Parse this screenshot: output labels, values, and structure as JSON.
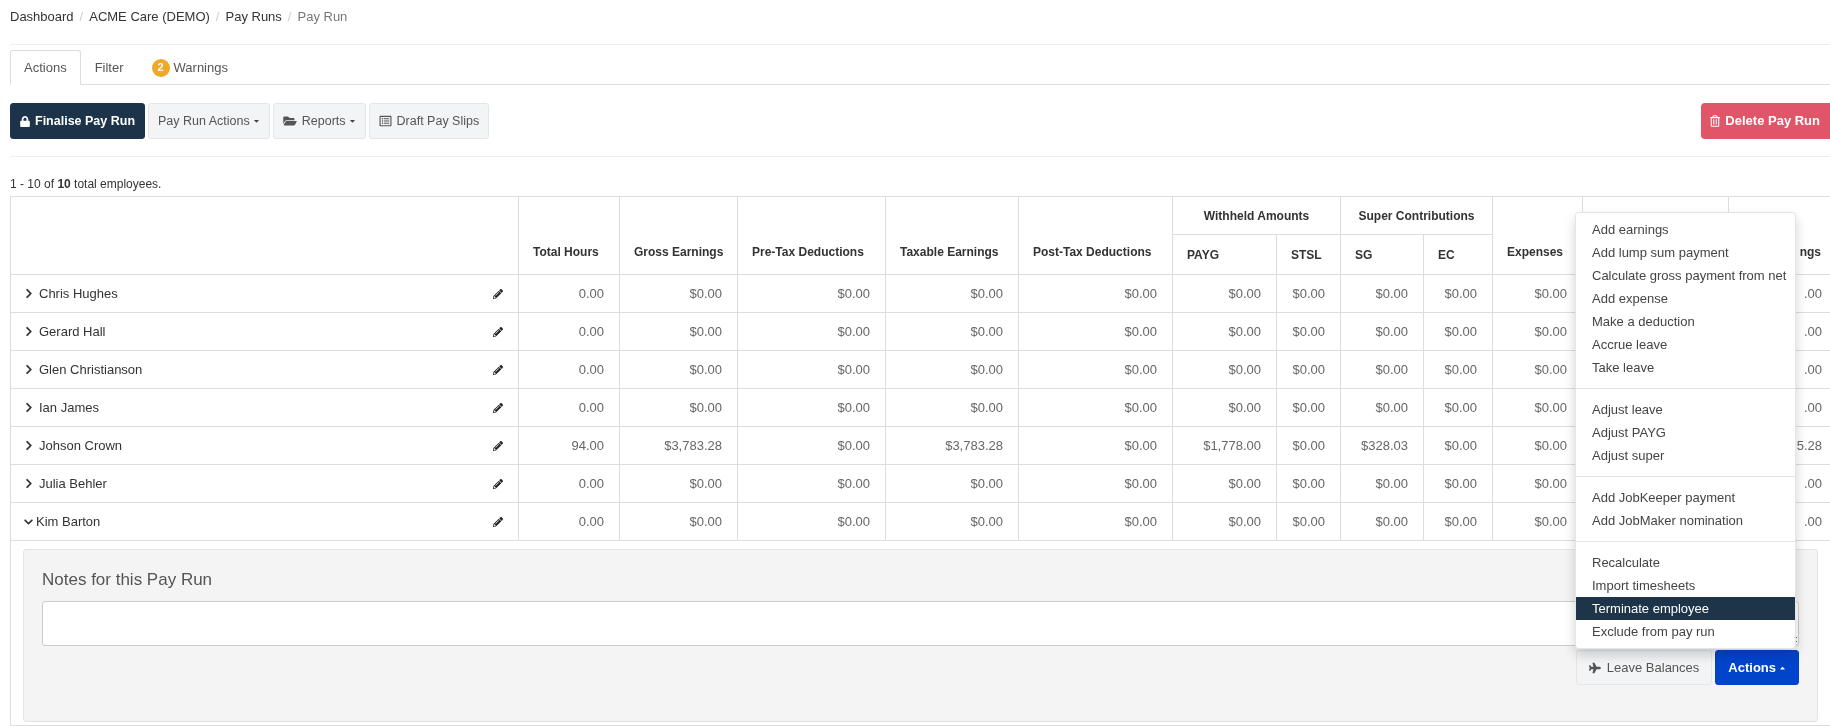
{
  "breadcrumb": {
    "separator": "/",
    "items": [
      {
        "label": "Dashboard",
        "current": false
      },
      {
        "label": "ACME Care (DEMO)",
        "current": false
      },
      {
        "label": "Pay Runs",
        "current": false
      },
      {
        "label": "Pay Run",
        "current": true
      }
    ]
  },
  "tabs": [
    {
      "label": "Actions",
      "selected": true
    },
    {
      "label": "Filter",
      "selected": false
    },
    {
      "label": "Warnings",
      "selected": false,
      "badge": "2"
    }
  ],
  "toolbar": {
    "buttons": [
      {
        "label": "Finalise Pay Run",
        "kind": "primary"
      },
      {
        "label": "Pay Run Actions",
        "kind": "dropdown"
      },
      {
        "label": "Reports",
        "kind": "dropdown"
      },
      {
        "label": "Draft Pay Slips",
        "kind": "default"
      }
    ],
    "delete_button": {
      "label": "Delete Pay Run"
    }
  },
  "summary": "1 - 10 of **10** total employees.",
  "table": {
    "columns": [
      {
        "label": "Total Hours"
      },
      {
        "label": "Gross Earnings"
      },
      {
        "label": "Pre-Tax Deductions"
      },
      {
        "label": "Taxable Earnings"
      },
      {
        "label": "Post-Tax Deductions"
      },
      {
        "group": "Withheld Amounts",
        "children": [
          {
            "label": "PAYG"
          },
          {
            "label": "STSL"
          }
        ]
      },
      {
        "group": "Super Contributions",
        "children": [
          {
            "label": "SG"
          },
          {
            "label": "EC"
          }
        ]
      },
      {
        "label": "Expenses"
      },
      {
        "label": "ngs"
      }
    ],
    "rows": [
      {
        "name": "Chris Hughes",
        "expanded": false,
        "values": [
          "0.00",
          "$0.00",
          "$0.00",
          "$0.00",
          "$0.00",
          "$0.00",
          "$0.00",
          "$0.00",
          "$0.00",
          "$0.00",
          ".00"
        ]
      },
      {
        "name": "Gerard Hall",
        "expanded": false,
        "values": [
          "0.00",
          "$0.00",
          "$0.00",
          "$0.00",
          "$0.00",
          "$0.00",
          "$0.00",
          "$0.00",
          "$0.00",
          "$0.00",
          ".00"
        ]
      },
      {
        "name": "Glen Christianson",
        "expanded": false,
        "values": [
          "0.00",
          "$0.00",
          "$0.00",
          "$0.00",
          "$0.00",
          "$0.00",
          "$0.00",
          "$0.00",
          "$0.00",
          "$0.00",
          ".00"
        ]
      },
      {
        "name": "Ian James",
        "expanded": false,
        "values": [
          "0.00",
          "$0.00",
          "$0.00",
          "$0.00",
          "$0.00",
          "$0.00",
          "$0.00",
          "$0.00",
          "$0.00",
          "$0.00",
          ".00"
        ]
      },
      {
        "name": "Johson Crown",
        "expanded": false,
        "values": [
          "94.00",
          "$3,783.28",
          "$0.00",
          "$3,783.28",
          "$0.00",
          "$1,778.00",
          "$0.00",
          "$328.03",
          "$0.00",
          "$0.00",
          "5.28"
        ]
      },
      {
        "name": "Julia Behler",
        "expanded": false,
        "values": [
          "0.00",
          "$0.00",
          "$0.00",
          "$0.00",
          "$0.00",
          "$0.00",
          "$0.00",
          "$0.00",
          "$0.00",
          "$0.00",
          ".00"
        ]
      },
      {
        "name": "Kim Barton",
        "expanded": true,
        "values": [
          "0.00",
          "$0.00",
          "$0.00",
          "$0.00",
          "$0.00",
          "$0.00",
          "$0.00",
          "$0.00",
          "$0.00",
          "$0.00",
          ".00"
        ]
      }
    ]
  },
  "detail_panel": {
    "title": "Notes for this Pay Run",
    "buttons": [
      {
        "label": "Leave Balances",
        "kind": "default"
      },
      {
        "label": "Actions",
        "kind": "menu"
      }
    ],
    "actions_menu": {
      "open": true,
      "sections": [
        {
          "items": [
            {
              "label": "Add earnings",
              "highlighted": false
            },
            {
              "label": "Add lump sum payment",
              "highlighted": false
            },
            {
              "label": "Calculate gross payment from net",
              "highlighted": false
            },
            {
              "label": "Add expense",
              "highlighted": false
            },
            {
              "label": "Make a deduction",
              "highlighted": false
            },
            {
              "label": "Accrue leave",
              "highlighted": false
            },
            {
              "label": "Take leave",
              "highlighted": false
            }
          ]
        },
        {
          "items": [
            {
              "label": "Adjust leave",
              "highlighted": false
            },
            {
              "label": "Adjust PAYG",
              "highlighted": false
            },
            {
              "label": "Adjust super",
              "highlighted": false
            }
          ]
        },
        {
          "items": [
            {
              "label": "Add JobKeeper payment",
              "highlighted": false
            },
            {
              "label": "Add JobMaker nomination",
              "highlighted": false
            }
          ]
        },
        {
          "items": [
            {
              "label": "Recalculate",
              "highlighted": false
            },
            {
              "label": "Import timesheets",
              "highlighted": false
            },
            {
              "label": "Terminate employee",
              "highlighted": true
            },
            {
              "label": "Exclude from pay run",
              "highlighted": false
            }
          ]
        }
      ]
    }
  }
}
